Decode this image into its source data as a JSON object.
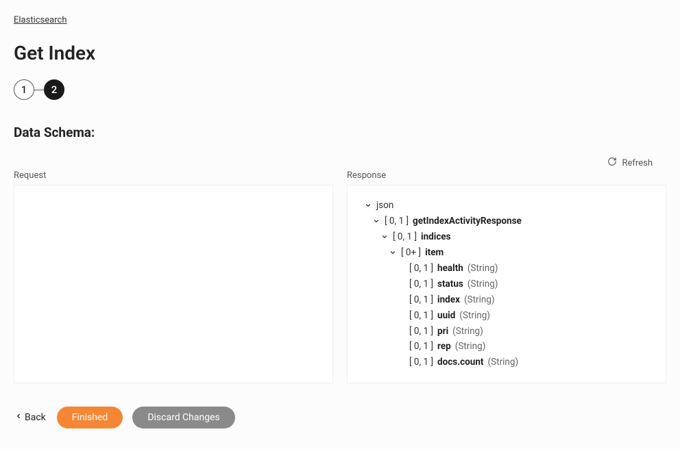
{
  "breadcrumb": {
    "label": "Elasticsearch"
  },
  "title": "Get Index",
  "stepper": {
    "steps": [
      "1",
      "2"
    ],
    "active_index": 1
  },
  "section_title": "Data Schema:",
  "refresh_label": "Refresh",
  "panels": {
    "request_label": "Request",
    "response_label": "Response"
  },
  "tree": {
    "root": "json",
    "l1_range": "[ 0, 1 ]",
    "l1_name": "getIndexActivityResponse",
    "l2_range": "[ 0, 1 ]",
    "l2_name": "indices",
    "l3_range": "[ 0+ ]",
    "l3_name": "item",
    "fields": [
      {
        "range": "[ 0, 1 ]",
        "name": "health",
        "type": "(String)"
      },
      {
        "range": "[ 0, 1 ]",
        "name": "status",
        "type": "(String)"
      },
      {
        "range": "[ 0, 1 ]",
        "name": "index",
        "type": "(String)"
      },
      {
        "range": "[ 0, 1 ]",
        "name": "uuid",
        "type": "(String)"
      },
      {
        "range": "[ 0, 1 ]",
        "name": "pri",
        "type": "(String)"
      },
      {
        "range": "[ 0, 1 ]",
        "name": "rep",
        "type": "(String)"
      },
      {
        "range": "[ 0, 1 ]",
        "name": "docs.count",
        "type": "(String)"
      }
    ]
  },
  "footer": {
    "back": "Back",
    "finished": "Finished",
    "discard": "Discard Changes"
  }
}
